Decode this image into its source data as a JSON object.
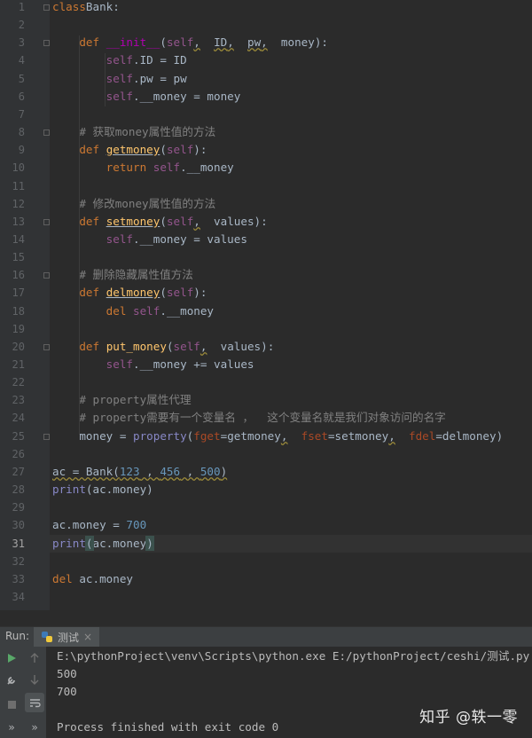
{
  "editor": {
    "line_numbers": [
      "1",
      "2",
      "3",
      "4",
      "5",
      "6",
      "7",
      "8",
      "9",
      "10",
      "11",
      "12",
      "13",
      "14",
      "15",
      "16",
      "17",
      "18",
      "19",
      "20",
      "21",
      "22",
      "23",
      "24",
      "25",
      "26",
      "27",
      "28",
      "29",
      "30",
      "31",
      "32",
      "33",
      "34"
    ],
    "current_line": "31",
    "lines": [
      [
        [
          "kw",
          "class"
        ],
        [
          "",
          "Bank:"
        ]
      ],
      [],
      [
        [
          "",
          "    "
        ],
        [
          "kw",
          "def "
        ],
        [
          "mg",
          "__init__"
        ],
        [
          "",
          "("
        ],
        [
          "sf",
          "self"
        ],
        [
          "w",
          ","
        ],
        [
          "",
          "  "
        ],
        [
          "w",
          "ID"
        ],
        [
          "w",
          ","
        ],
        [
          "",
          ""
        ],
        [
          "",
          ""
        ],
        [
          "",
          "  "
        ],
        [
          "w",
          "pw"
        ],
        [
          "w",
          ","
        ],
        [
          "",
          "  money):"
        ]
      ],
      [
        [
          "",
          "        "
        ],
        [
          "sf",
          "self"
        ],
        [
          "",
          ".ID = ID"
        ]
      ],
      [
        [
          "",
          "        "
        ],
        [
          "sf",
          "self"
        ],
        [
          "",
          ".pw = pw"
        ]
      ],
      [
        [
          "",
          "        "
        ],
        [
          "sf",
          "self"
        ],
        [
          "",
          ".__money = money"
        ]
      ],
      [],
      [
        [
          "",
          "    "
        ],
        [
          "cm",
          "# 获取money属性值的方法"
        ]
      ],
      [
        [
          "",
          "    "
        ],
        [
          "kw",
          "def "
        ],
        [
          "fnu",
          "getmoney"
        ],
        [
          "",
          "("
        ],
        [
          "sf",
          "self"
        ],
        [
          "",
          "):"
        ]
      ],
      [
        [
          "",
          "        "
        ],
        [
          "kw",
          "return "
        ],
        [
          "sf",
          "self"
        ],
        [
          "",
          ".__money"
        ]
      ],
      [],
      [
        [
          "",
          "    "
        ],
        [
          "cm",
          "# 修改money属性值的方法"
        ]
      ],
      [
        [
          "",
          "    "
        ],
        [
          "kw",
          "def "
        ],
        [
          "fnu",
          "setmoney"
        ],
        [
          "",
          "("
        ],
        [
          "sf",
          "self"
        ],
        [
          "w",
          ","
        ],
        [
          "",
          "  values):"
        ]
      ],
      [
        [
          "",
          "        "
        ],
        [
          "sf",
          "self"
        ],
        [
          "",
          ".__money = values"
        ]
      ],
      [],
      [
        [
          "",
          "    "
        ],
        [
          "cm",
          "# 删除隐藏属性值方法"
        ]
      ],
      [
        [
          "",
          "    "
        ],
        [
          "kw",
          "def "
        ],
        [
          "fnu",
          "delmoney"
        ],
        [
          "",
          "("
        ],
        [
          "sf",
          "self"
        ],
        [
          "",
          "):"
        ]
      ],
      [
        [
          "",
          "        "
        ],
        [
          "kw",
          "del "
        ],
        [
          "sf",
          "self"
        ],
        [
          "",
          ".__money"
        ]
      ],
      [],
      [
        [
          "",
          "    "
        ],
        [
          "kw",
          "def "
        ],
        [
          "fn",
          "put_money"
        ],
        [
          "",
          "("
        ],
        [
          "sf",
          "self"
        ],
        [
          "w",
          ","
        ],
        [
          "",
          "  values):"
        ]
      ],
      [
        [
          "",
          "        "
        ],
        [
          "sf",
          "self"
        ],
        [
          "",
          ".__money += values"
        ]
      ],
      [],
      [
        [
          "",
          "    "
        ],
        [
          "cm",
          "# property属性代理"
        ]
      ],
      [
        [
          "",
          "    "
        ],
        [
          "cm",
          "# property需要有一个变量名 ，  这个变量名就是我们对象访问的名字"
        ]
      ],
      [
        [
          "",
          "    money = "
        ],
        [
          "bi",
          "property"
        ],
        [
          "",
          "("
        ],
        [
          "pm",
          "fget"
        ],
        [
          "",
          "=getmoney"
        ],
        [
          "w",
          ","
        ],
        [
          "",
          "  "
        ],
        [
          "pm",
          "fset"
        ],
        [
          "",
          "=setmoney"
        ],
        [
          "w",
          ","
        ],
        [
          "",
          "  "
        ],
        [
          "pm",
          "fdel"
        ],
        [
          "",
          "=delmoney)"
        ]
      ],
      [],
      [
        [
          "w",
          "ac = Bank("
        ],
        [
          "nbw",
          "123"
        ],
        [
          "w",
          " , "
        ],
        [
          "nbw",
          "456"
        ],
        [
          "w",
          " , "
        ],
        [
          "nbw",
          "500"
        ],
        [
          "w",
          ")"
        ]
      ],
      [
        [
          "bi",
          "print"
        ],
        [
          "",
          "(ac.money)"
        ]
      ],
      [],
      [
        [
          "",
          "ac.money = "
        ],
        [
          "nb",
          "700"
        ]
      ],
      [
        [
          "bi",
          "print"
        ],
        [
          "hl",
          "("
        ],
        [
          "",
          "ac.money"
        ],
        [
          "hl",
          ")"
        ]
      ],
      [],
      [
        [
          "kw",
          "del "
        ],
        [
          "",
          "ac.money"
        ]
      ],
      []
    ]
  },
  "run_panel": {
    "label": "Run:",
    "tab_name": "测试",
    "tab_close": "×",
    "console_lines": [
      "E:\\pythonProject\\venv\\Scripts\\python.exe E:/pythonProject/ceshi/测试.py",
      "500",
      "700",
      "",
      "Process finished with exit code 0"
    ],
    "colors": {
      "run_icon": "#59a869",
      "stop_icon": "#6e6e6e",
      "console_text": "#bbbbbb"
    }
  },
  "watermark": "知乎 @轶一零"
}
